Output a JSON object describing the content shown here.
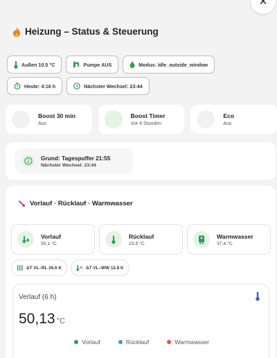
{
  "header": {
    "title": "Heizung – Status & Steuerung",
    "icon": "flame-icon"
  },
  "chips": [
    {
      "icon": "thermometer-icon",
      "label": "Außen 10.5 °C"
    },
    {
      "icon": "pump-icon",
      "label": "Pumpe AUS"
    },
    {
      "icon": "water-drop-icon",
      "label": "Modus: Idle_outside_window"
    },
    {
      "icon": "timer-icon",
      "label": "Heute: 4:16 h"
    },
    {
      "icon": "clock-icon",
      "label": "Nächster Wechsel: 23:44"
    }
  ],
  "tiles": [
    {
      "title": "Boost 30 min",
      "state": "Aus"
    },
    {
      "title": "Boost Timer",
      "state": "Vor 4 Stunden"
    },
    {
      "title": "Eco",
      "state": "Aus"
    }
  ],
  "reason": {
    "line1": "Grund: Tagespuffer 21:55",
    "line2": "Nächster Wechsel: 23:44"
  },
  "temps": {
    "section_title": "Vorlauf · Rücklauf · Warmwasser",
    "cards": [
      {
        "name": "Vorlauf",
        "value": "50,1 °C",
        "color": "#2e9e4e"
      },
      {
        "name": "Rücklauf",
        "value": "23,5 °C",
        "color": "#2e9e4e"
      },
      {
        "name": "Warmwasser",
        "value": "37,4 °C",
        "color": "#2e9e4e"
      }
    ],
    "deltas": [
      {
        "label": "ΔT VL–RL 26.6 K"
      },
      {
        "label": "ΔT VL–WW 12.8 K"
      }
    ]
  },
  "history": {
    "title": "Verlauf (6 h)",
    "value": "50,13",
    "unit": "°C",
    "legend": [
      {
        "name": "Vorlauf",
        "color": "#2e9e4e"
      },
      {
        "name": "Rücklauf",
        "color": "#3a9bd6"
      },
      {
        "name": "Warmwasser",
        "color": "#e0533d"
      }
    ]
  },
  "colors": {
    "accent_green": "#2e9e4e",
    "flame": "#f07a1a",
    "thermo_blue": "#3f63c9"
  }
}
